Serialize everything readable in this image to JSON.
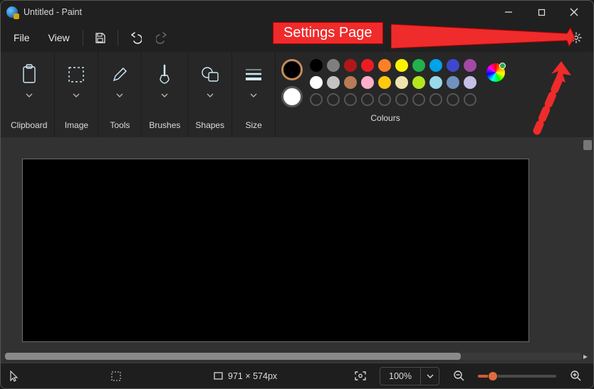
{
  "title": "Untitled - Paint",
  "menu": {
    "file": "File",
    "view": "View"
  },
  "ribbon": {
    "clipboard": "Clipboard",
    "image": "Image",
    "tools": "Tools",
    "brushes": "Brushes",
    "shapes": "Shapes",
    "size": "Size",
    "colours": "Colours"
  },
  "colors": {
    "primary": "#000000",
    "secondary": "#ffffff",
    "row1": [
      "#000000",
      "#7f7f7f",
      "#b01818",
      "#ed1c24",
      "#ff7f27",
      "#fff200",
      "#22b14c",
      "#00a2e8",
      "#3f48cc",
      "#a349a4"
    ],
    "row2": [
      "#ffffff",
      "#c3c3c3",
      "#b97a57",
      "#ffaec9",
      "#ffc90e",
      "#efe4b0",
      "#b5e61d",
      "#99d9ea",
      "#7092be",
      "#c8bfe7"
    ]
  },
  "status": {
    "dimensions": "971 × 574px",
    "zoom": "100%"
  },
  "annotation": {
    "label": "Settings Page"
  }
}
